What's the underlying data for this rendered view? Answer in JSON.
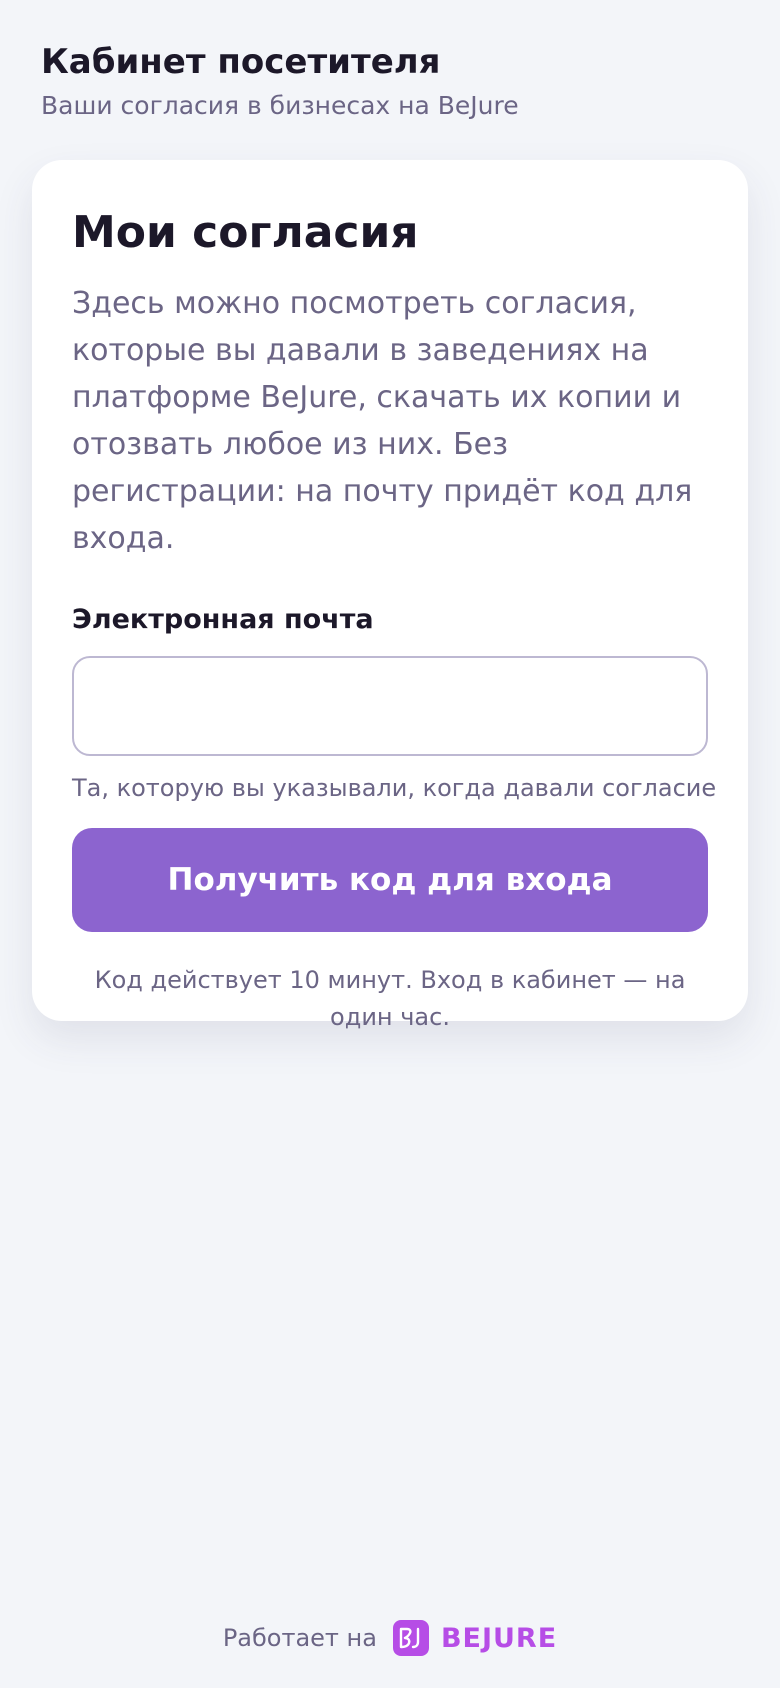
{
  "header": {
    "title": "Кабинет посетителя",
    "subtitle": "Ваши согласия в бизнесах на BeJure"
  },
  "card": {
    "title": "Мои согласия",
    "description": "Здесь можно посмотреть согласия, которые вы давали в заведениях на платформе BeJure, скачать их копии и отозвать любое из них. Без регистрации: на почту придёт код для входа.",
    "email": {
      "label": "Электронная почта",
      "value": "",
      "placeholder": "",
      "hint": "Та, которую вы указывали, когда давали согласие"
    },
    "submit_label": "Получить код для входа",
    "note": "Код действует 10 минут. Вход в кабинет — на один час."
  },
  "footer": {
    "powered_by": "Работает на",
    "logo_icon": "bejure-logo-icon",
    "logo_text": "BEJURE"
  },
  "colors": {
    "background": "#f3f5f9",
    "accent": "#8c64cf",
    "brand": "#b64de6",
    "text_primary": "#1c1829",
    "text_secondary": "#6b6585"
  }
}
